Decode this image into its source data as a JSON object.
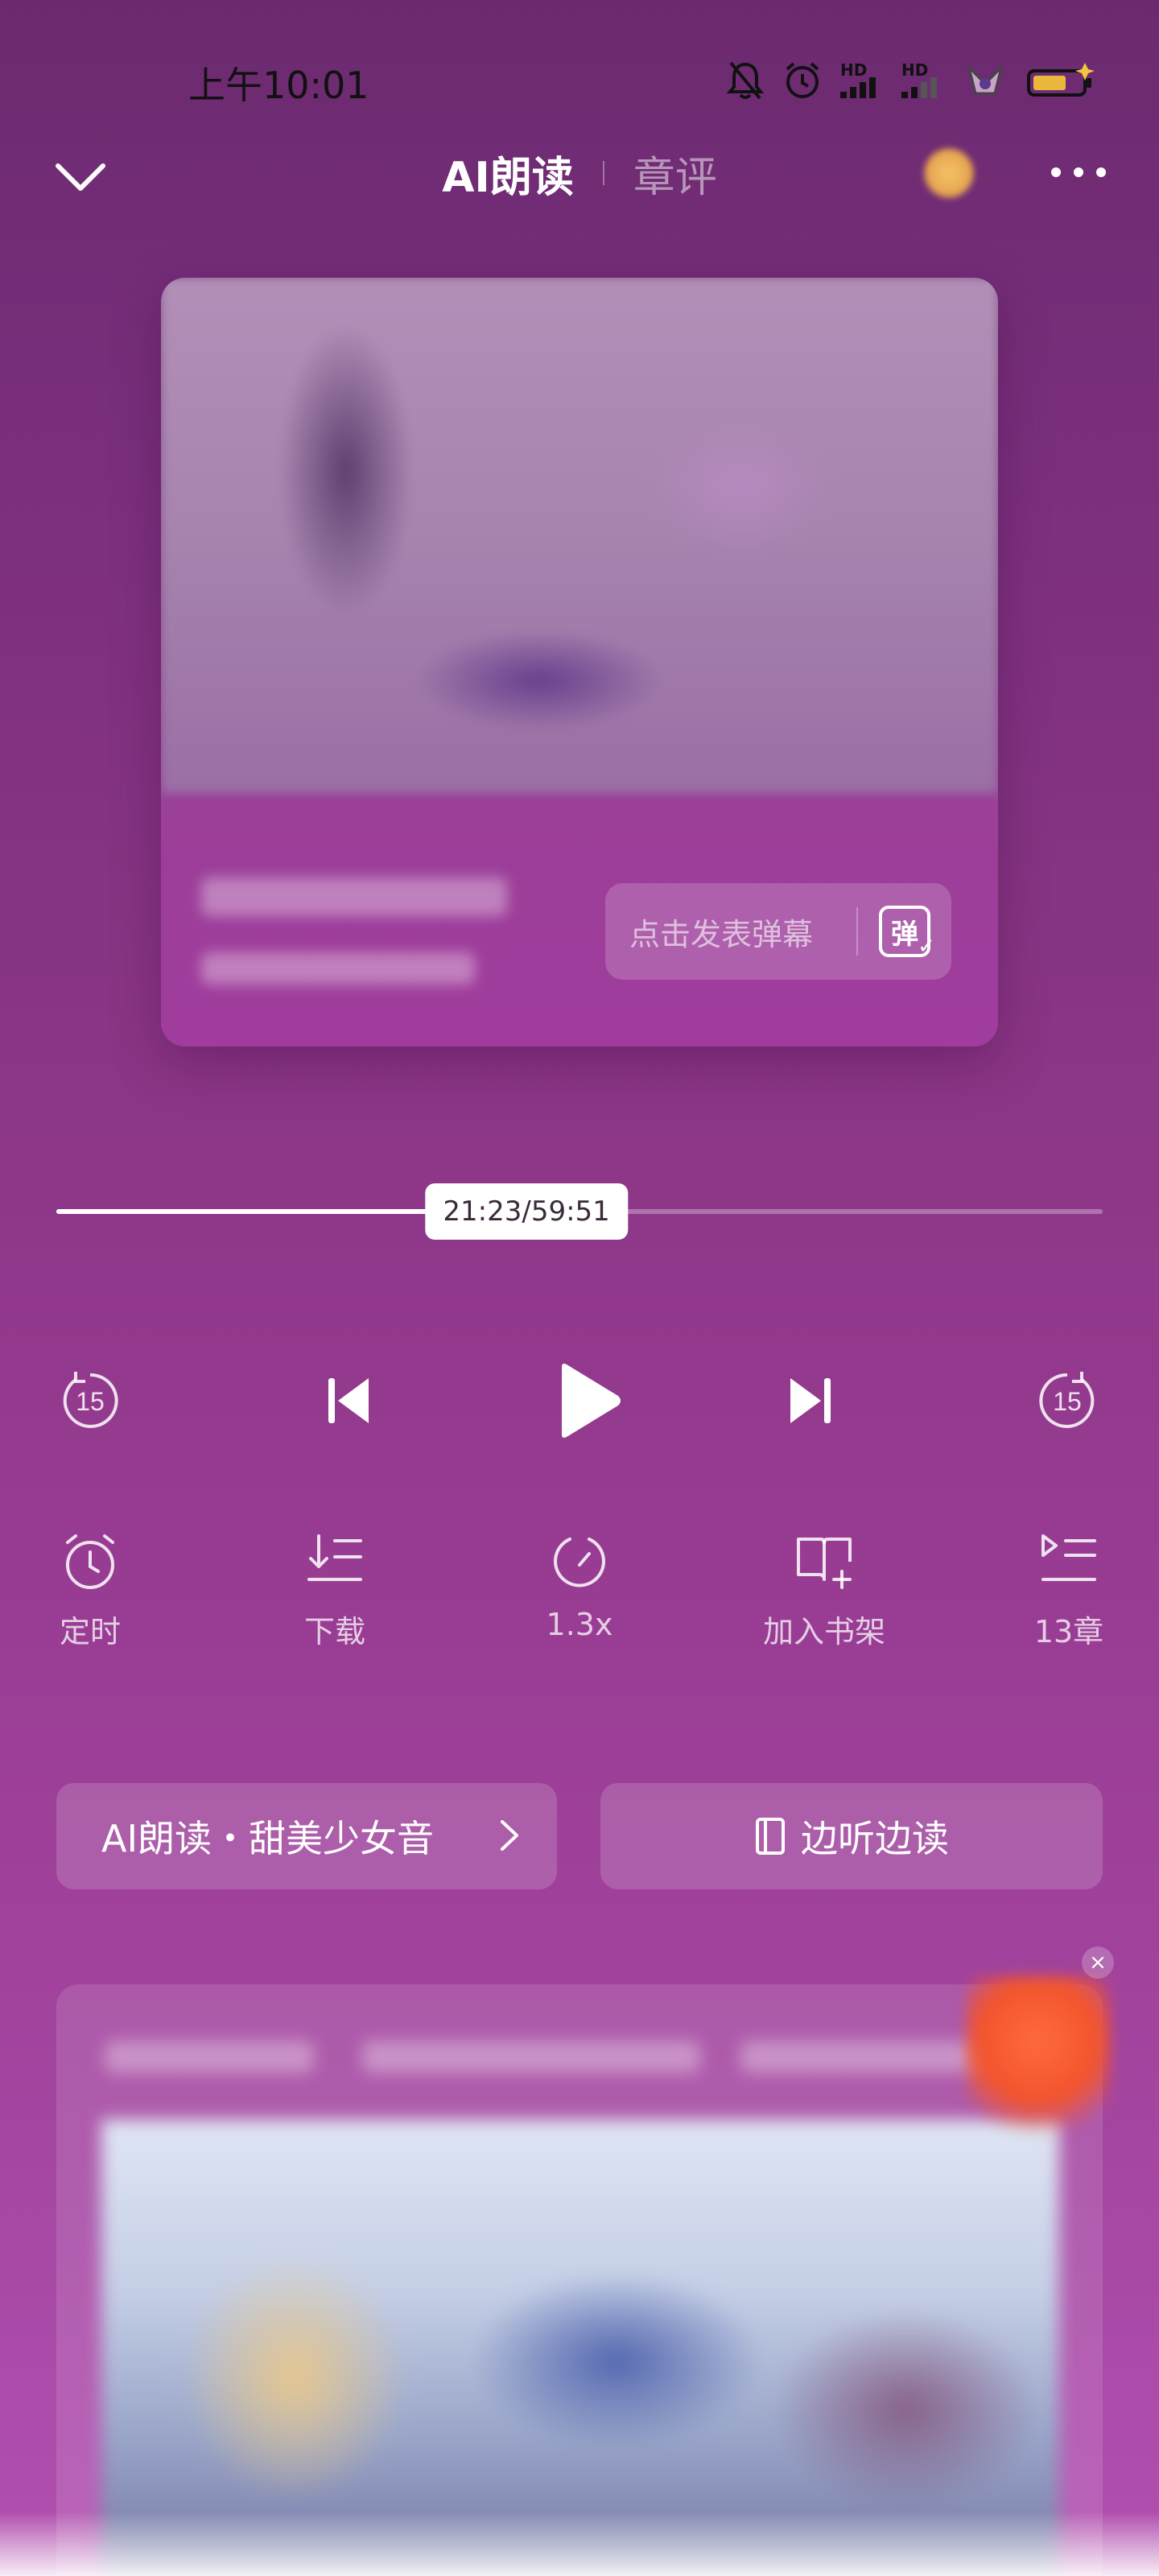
{
  "status_bar": {
    "time": "上午10:01",
    "icons": [
      "bell-off-icon",
      "alarm-icon",
      "hd-signal-icon",
      "hd-signal-icon",
      "app-notification-icon",
      "battery-icon"
    ],
    "hd_label": "HD"
  },
  "header": {
    "tabs": [
      {
        "label": "AI朗读",
        "active": true
      },
      {
        "label": "章评",
        "active": false
      }
    ],
    "back_icon": "chevron-down-icon",
    "more_icon": "more-dots-icon"
  },
  "cover": {
    "danmaku_placeholder": "点击发表弹幕",
    "danmaku_icon_text": "弹"
  },
  "playback": {
    "position_label": "21:23/59:51",
    "progress_fraction": 0.357,
    "controls": [
      {
        "name": "rewind-15",
        "icon": "rewind-15-icon",
        "text": "15"
      },
      {
        "name": "previous-chapter",
        "icon": "skip-previous-icon"
      },
      {
        "name": "play",
        "icon": "play-icon"
      },
      {
        "name": "next-chapter",
        "icon": "skip-next-icon"
      },
      {
        "name": "forward-15",
        "icon": "forward-15-icon",
        "text": "15"
      }
    ]
  },
  "actions": [
    {
      "label": "定时",
      "icon": "alarm-clock-icon"
    },
    {
      "label": "下载",
      "icon": "download-list-icon"
    },
    {
      "label": "1.3x",
      "icon": "speed-gauge-icon"
    },
    {
      "label": "加入书架",
      "icon": "add-bookshelf-icon"
    },
    {
      "label": "13章",
      "icon": "chapter-list-icon"
    }
  ],
  "buttons": {
    "voice": "AI朗读・甜美少女音",
    "listen_read": "边听边读"
  },
  "ad": {
    "close_label": "×"
  },
  "colors": {
    "background_top": "#6b2a6f",
    "background_bottom": "#b24fb0",
    "accent": "#ffffff"
  }
}
